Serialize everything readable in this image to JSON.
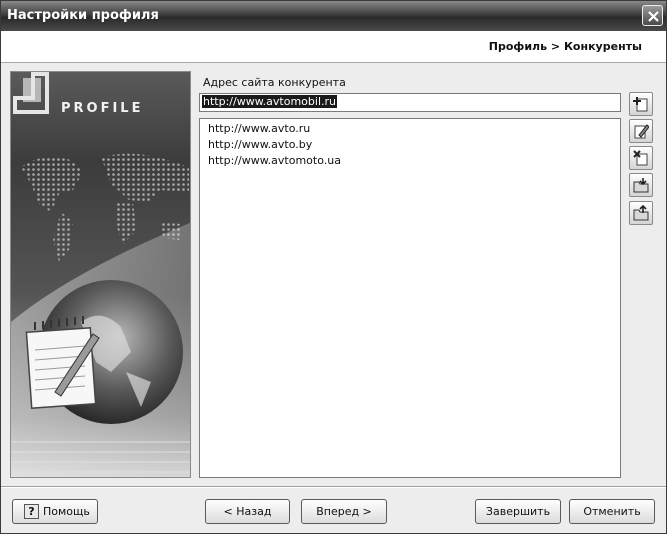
{
  "window": {
    "title": "Настройки профиля"
  },
  "header": {
    "breadcrumb": "Профиль > Конкуренты"
  },
  "sidebar": {
    "logo_text": "PROFILE"
  },
  "form": {
    "site_label": "Адрес сайта конкурента",
    "site_value": "http://www.avtomobil.ru"
  },
  "list": {
    "items": [
      "http://www.avto.ru",
      "http://www.avto.by",
      "http://www.avtomoto.ua"
    ]
  },
  "toolbar": {
    "icons": [
      "add-icon",
      "edit-icon",
      "delete-icon",
      "import-icon",
      "export-icon"
    ]
  },
  "buttons": {
    "help": "Помощь",
    "back": "< Назад",
    "next": "Вперед >",
    "finish": "Завершить",
    "cancel": "Отменить"
  }
}
